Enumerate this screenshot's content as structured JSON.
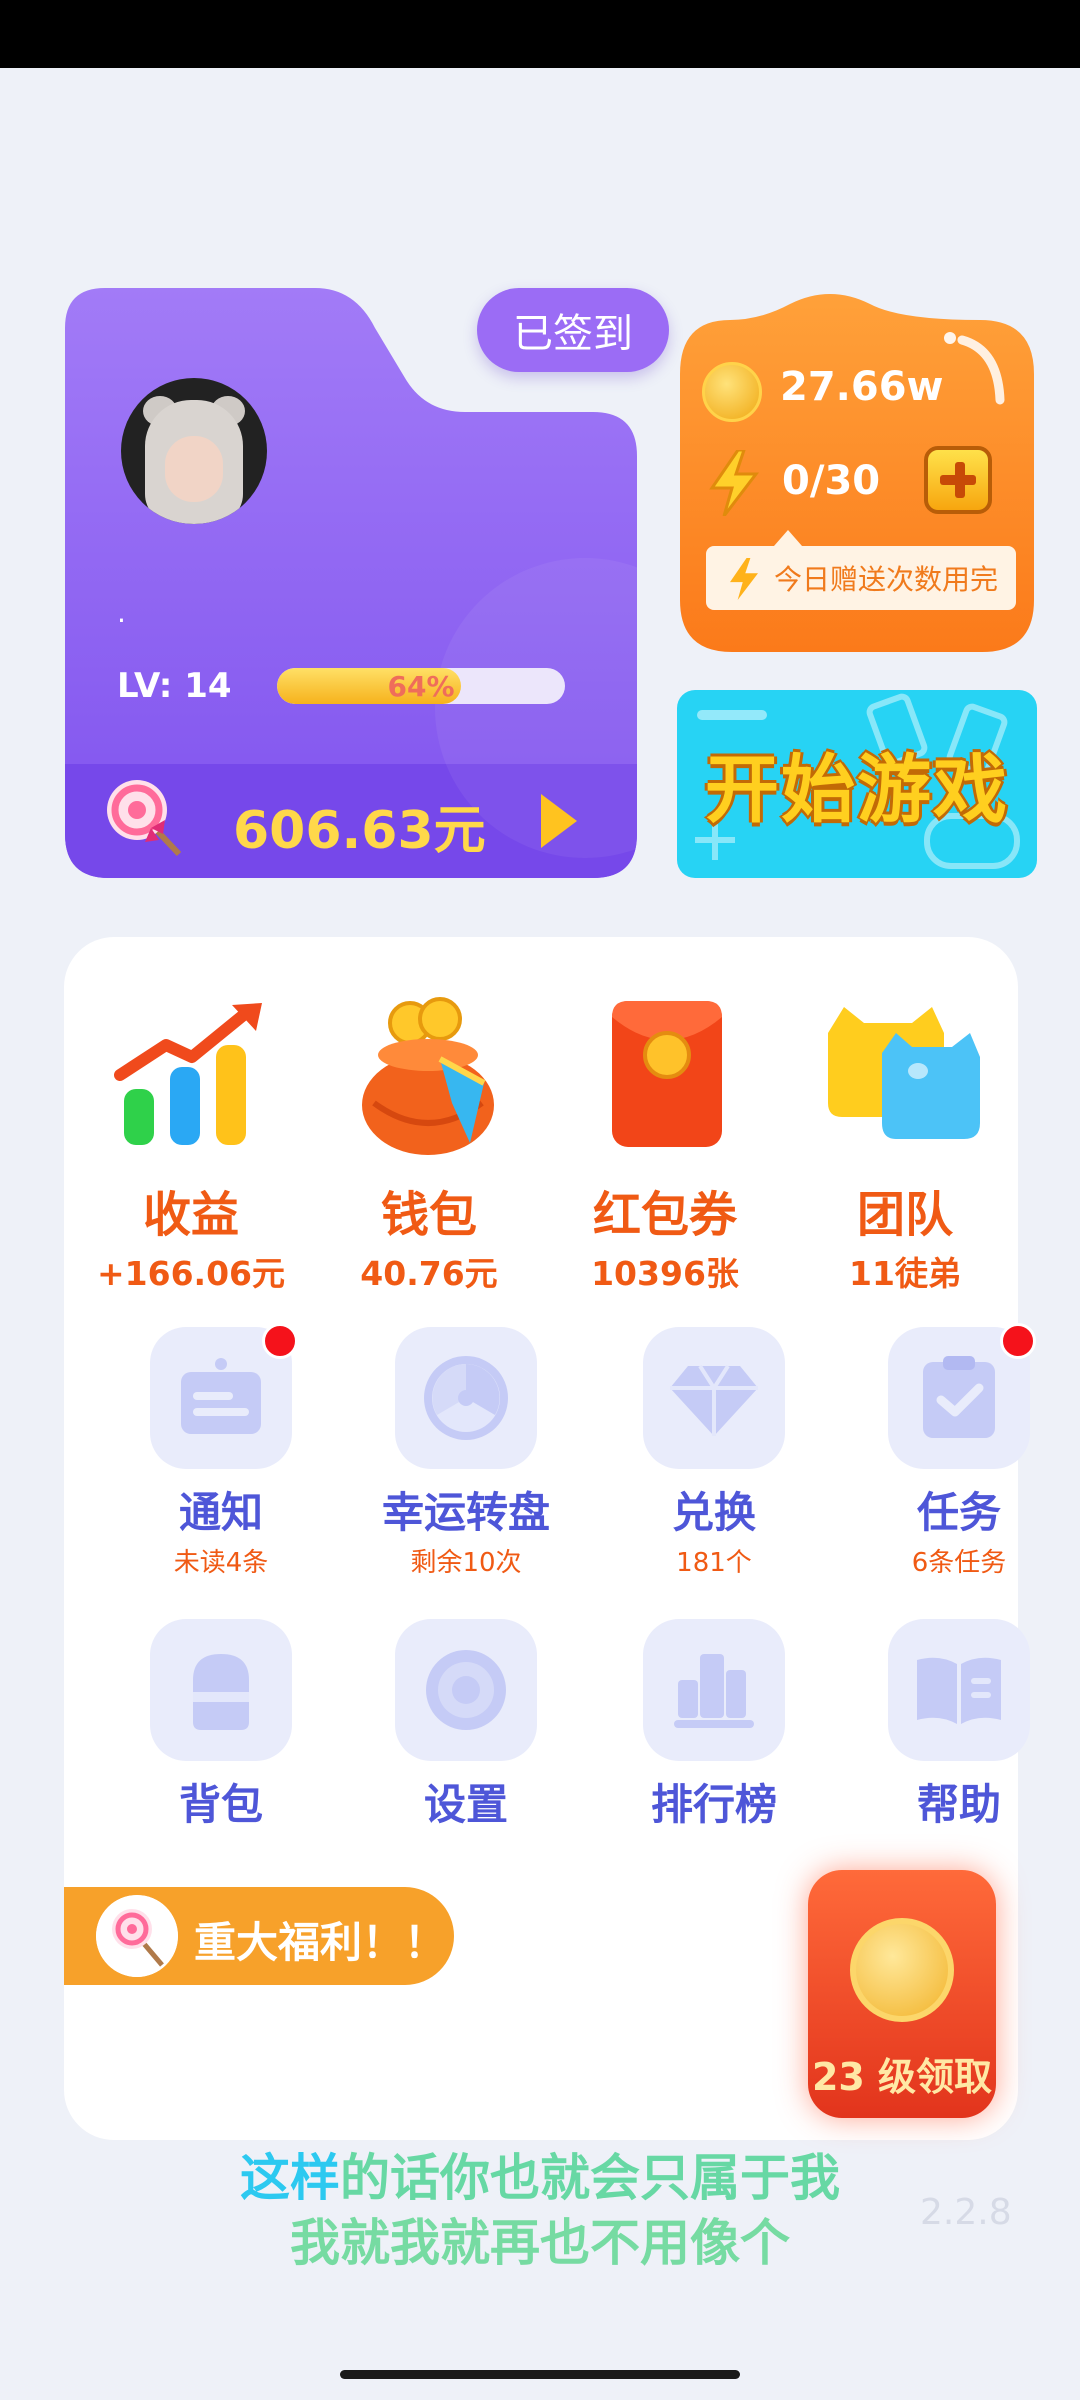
{
  "profile": {
    "sign_status": "已签到",
    "nickname": ".",
    "level_label": "LV: 14",
    "progress": 0.64,
    "progress_text": "64%",
    "balance": "606.63元"
  },
  "resources": {
    "coins": "27.66w",
    "energy": "0/30",
    "tip": "今日赠送次数用完"
  },
  "start_game": "开始游戏",
  "top_items": [
    {
      "label": "收益",
      "value": "+166.06元"
    },
    {
      "label": "钱包",
      "value": "40.76元"
    },
    {
      "label": "红包券",
      "value": "10396张"
    },
    {
      "label": "团队",
      "value": "11徒弟"
    }
  ],
  "grid_row1": [
    {
      "label": "通知",
      "sub": "未读4条",
      "icon": "notice-icon",
      "badge": true
    },
    {
      "label": "幸运转盘",
      "sub": "剩余10次",
      "icon": "wheel-icon",
      "badge": false
    },
    {
      "label": "兑换",
      "sub": "181个",
      "icon": "diamond-icon",
      "badge": false
    },
    {
      "label": "任务",
      "sub": "6条任务",
      "icon": "task-icon",
      "badge": true
    }
  ],
  "grid_row2": [
    {
      "label": "背包",
      "icon": "backpack-icon"
    },
    {
      "label": "设置",
      "icon": "gear-icon"
    },
    {
      "label": "排行榜",
      "icon": "rank-icon"
    },
    {
      "label": "帮助",
      "icon": "help-book-icon"
    }
  ],
  "welfare": "重大福利！！",
  "level_reward": "23 级领取",
  "subtitle": {
    "line1_a": "这样",
    "line1_b": "的话你也就会只属于我",
    "line2": "我就我就再也不用像个"
  },
  "version": "2.2.8"
}
